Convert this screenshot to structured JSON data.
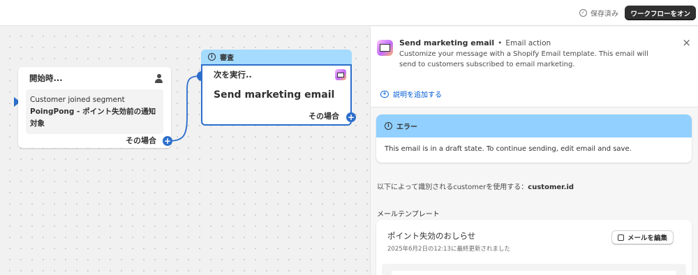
{
  "topbar": {
    "saved_status": "保存済み",
    "turn_on_button": "ワークフローをオン"
  },
  "canvas": {
    "trigger": {
      "header": "開始時...",
      "line1": "Customer joined segment",
      "segment_name": "PoingPong - ポイント失効前の通知対象",
      "footer": "その場合"
    },
    "action": {
      "review_label": "審査",
      "header": "次を実行..",
      "title": "Send marketing email",
      "footer": "その場合"
    },
    "plus_glyph": "+"
  },
  "panel": {
    "title": "Send marketing email",
    "separator": "•",
    "subtitle": "Email action",
    "description": "Customize your message with a Shopify Email template. This email will send to customers subscribed to email marketing.",
    "close": "×",
    "add_description": "説明を追加する",
    "error": {
      "title": "エラー",
      "message": "This email is in a draft state. To continue sending, edit email and save."
    },
    "identify_prefix": "以下によって識別されるcustomerを使用する：",
    "identify_value": "customer.id",
    "template_label": "メールテンプレート",
    "template": {
      "name": "ポイント失効のおしらせ",
      "updated": "2025年6月2日の12:13に最終更新されました",
      "edit_button": "メールを編集"
    }
  },
  "colors": {
    "accent": "#2c6ecb",
    "review_bar": "#a4dbff",
    "error_header": "#91d0ff",
    "link": "#005bd3",
    "dark_button": "#303030"
  }
}
